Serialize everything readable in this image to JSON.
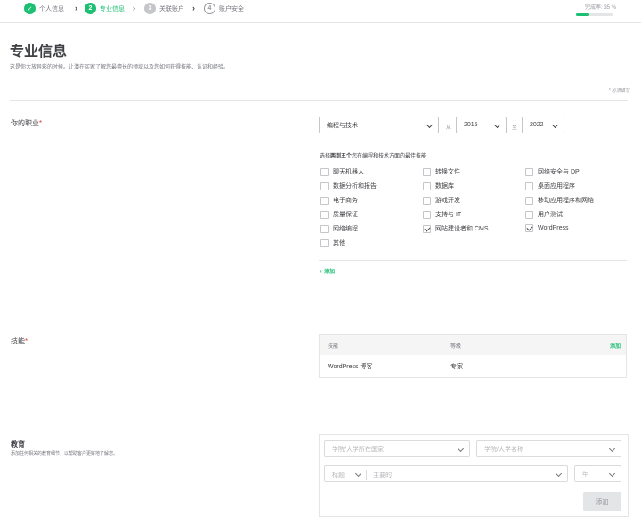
{
  "stepper": {
    "steps": [
      {
        "num": "✓",
        "label": "个人信息",
        "state": "done"
      },
      {
        "num": "2",
        "label": "专业信息",
        "state": "active"
      },
      {
        "num": "3",
        "label": "关联账户",
        "state": "pending"
      },
      {
        "num": "4",
        "label": "账户安全",
        "state": "outline"
      }
    ],
    "completion_label": "完成率: 35 %",
    "completion_percent": 35
  },
  "header": {
    "title": "专业信息",
    "intro": "这是你大放异彩的时候。让潜在买家了解您最擅长的领域以及您如何获得技能、认证和经验。",
    "required_note": "* 必须填写"
  },
  "occupation": {
    "label": "你的职业",
    "category": "编程与技术",
    "from_label": "从",
    "from_year": "2015",
    "to_label": "至",
    "to_year": "2022",
    "skills_hint_prefix": "选择",
    "skills_hint_bold": "两到五个",
    "skills_hint_suffix": "您在编程和技术方面的最佳技能",
    "skills": [
      {
        "label": "聊天机器人",
        "checked": false
      },
      {
        "label": "转换文件",
        "checked": false
      },
      {
        "label": "网络安全与 DP",
        "checked": false
      },
      {
        "label": "数据分析和报告",
        "checked": false
      },
      {
        "label": "数据库",
        "checked": false
      },
      {
        "label": "桌面应用程序",
        "checked": false
      },
      {
        "label": "电子商务",
        "checked": false
      },
      {
        "label": "游戏开发",
        "checked": false
      },
      {
        "label": "移动应用程序和网络",
        "checked": false
      },
      {
        "label": "质量保证",
        "checked": false
      },
      {
        "label": "支持与 IT",
        "checked": false
      },
      {
        "label": "用户测试",
        "checked": false
      },
      {
        "label": "网络编程",
        "checked": false
      },
      {
        "label": "网站建设者和 CMS",
        "checked": true
      },
      {
        "label": "WordPress",
        "checked": true
      },
      {
        "label": "其他",
        "checked": false
      }
    ],
    "add_link": "+ 添加"
  },
  "skills": {
    "label": "技能",
    "col_skill": "技能",
    "col_level": "等级",
    "add": "添加",
    "rows": [
      {
        "skill": "WordPress 博客",
        "level": "专家"
      }
    ]
  },
  "education": {
    "title": "教育",
    "desc": "添加任何相关的教育细节，以帮助客户更好地了解您。",
    "country_placeholder": "学院/大学所在国家",
    "school_placeholder": "学院/大学名称",
    "title_select": "标题",
    "major_placeholder": "主要的",
    "year_select": "年",
    "add_button": "添加"
  },
  "colors": {
    "accent": "#1dbf73",
    "required": "#e4453f",
    "text": "#404145"
  }
}
